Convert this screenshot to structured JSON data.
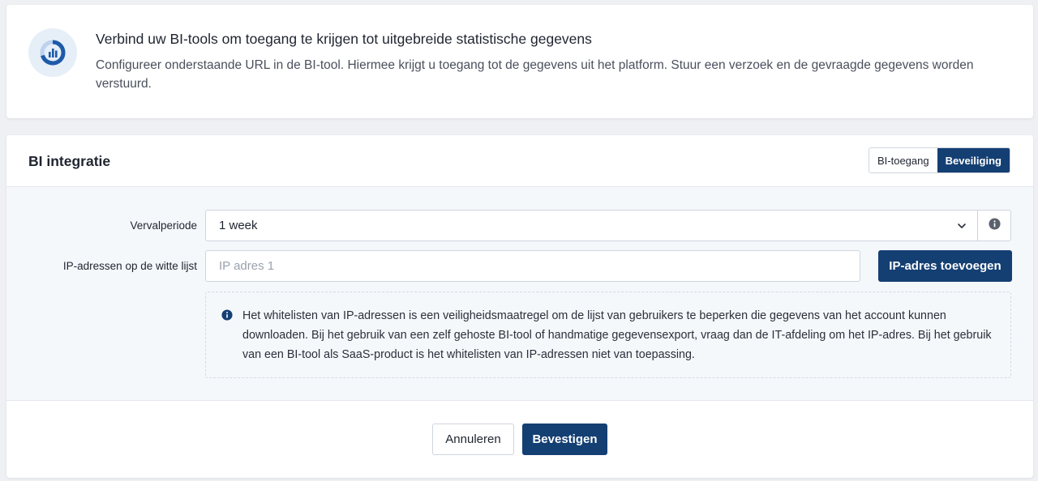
{
  "intro": {
    "icon": "chart-donut-icon",
    "title": "Verbind uw BI-tools om toegang te krijgen tot uitgebreide statistische gegevens",
    "description": "Configureer onderstaande URL in de BI-tool. Hiermee krijgt u toegang tot de gegevens uit het platform. Stuur een verzoek en de gevraagde gegevens worden verstuurd."
  },
  "card": {
    "title": "BI integratie",
    "tabs": [
      {
        "label": "BI-toegang",
        "active": false
      },
      {
        "label": "Beveiliging",
        "active": true
      }
    ]
  },
  "form": {
    "expiry": {
      "label": "Vervalperiode",
      "value": "1 week"
    },
    "whitelist": {
      "label": "IP-adressen op de witte lijst",
      "placeholder": "IP adres 1",
      "add_button": "IP-adres toevoegen"
    },
    "note": "Het whitelisten van IP-adressen is een veiligheidsmaatregel om de lijst van gebruikers te beperken die gegevens van het account kunnen downloaden. Bij het gebruik van een zelf gehoste BI-tool of handmatige gegevensexport, vraag dan de IT-afdeling om het IP-adres. Bij het gebruik van een BI-tool als SaaS-product is het whitelisten van IP-adressen niet van toepassing."
  },
  "footer": {
    "cancel": "Annuleren",
    "confirm": "Bevestigen"
  },
  "colors": {
    "primary": "#143f73",
    "icon_bg": "#e6eef8",
    "form_bg": "#f5f8fb"
  }
}
